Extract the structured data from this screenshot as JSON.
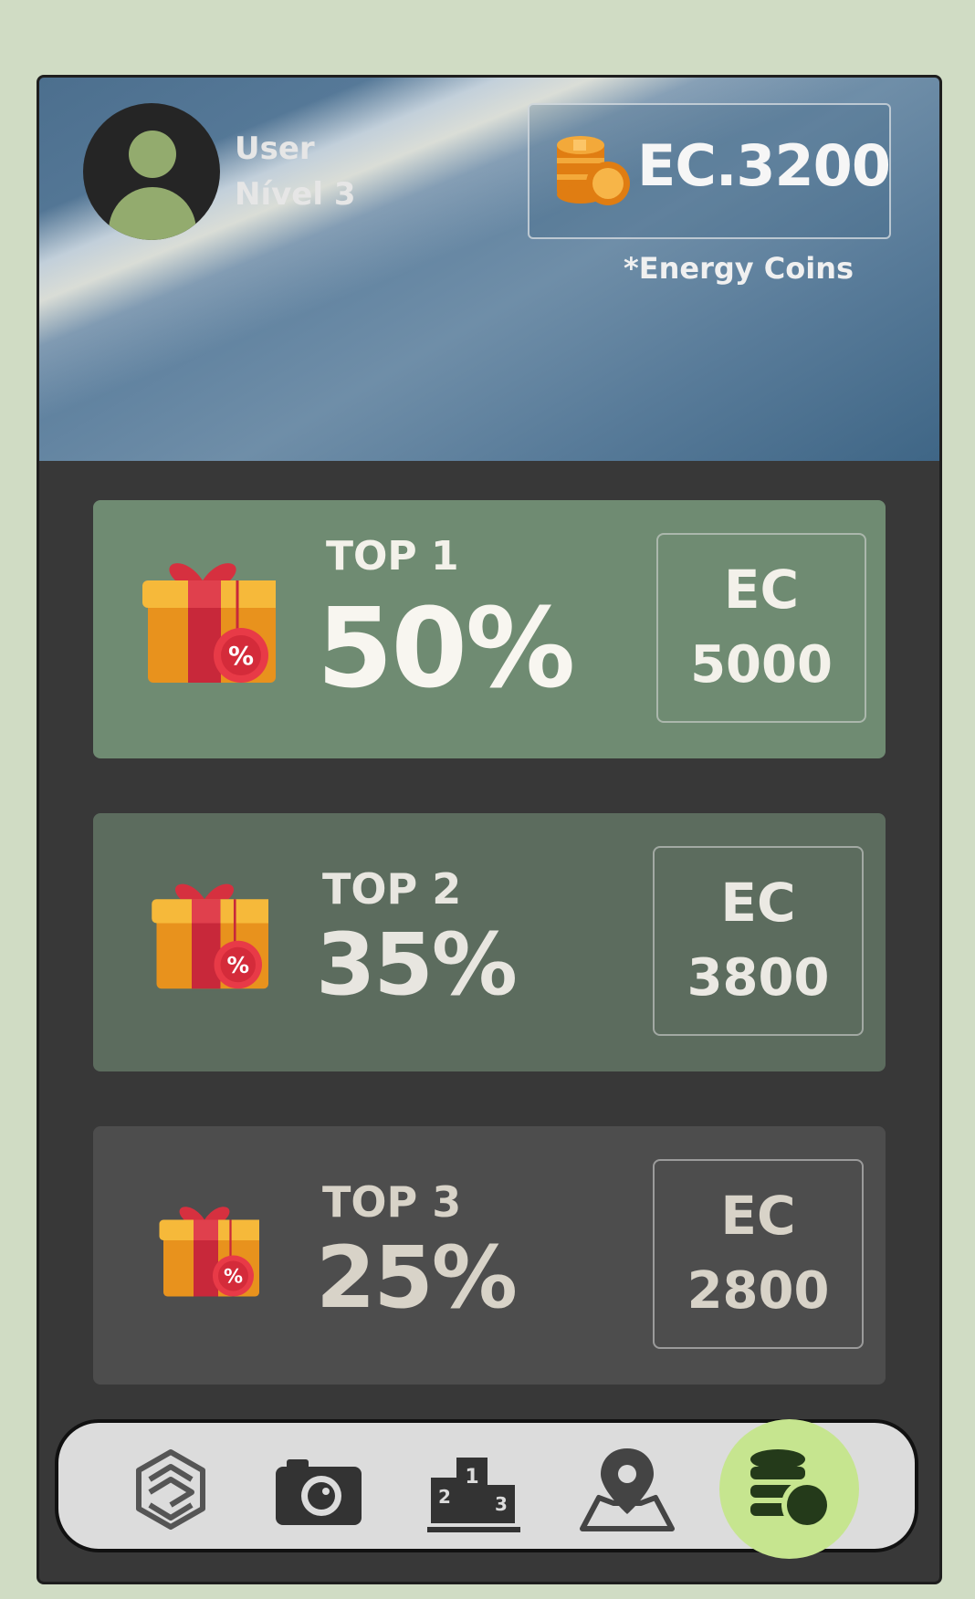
{
  "user": {
    "name": "User",
    "level": "Nível 3"
  },
  "wallet": {
    "balance": "EC.3200",
    "note": "*Energy Coins"
  },
  "rewards": [
    {
      "rank": "TOP 1",
      "discount": "50%",
      "currency": "EC",
      "cost": "5000"
    },
    {
      "rank": "TOP 2",
      "discount": "35%",
      "currency": "EC",
      "cost": "3800"
    },
    {
      "rank": "TOP 3",
      "discount": "25%",
      "currency": "EC",
      "cost": "2800"
    }
  ],
  "nav": {
    "items": [
      "logo-icon",
      "camera-icon",
      "podium-icon",
      "map-pin-icon",
      "coins-icon"
    ],
    "active": "coins-icon"
  },
  "colors": {
    "background": "#d0dcc4",
    "panel": "#383838",
    "card1": "#6f8b72",
    "card2": "#5c6c5e",
    "card3": "#4d4d4d",
    "accent": "#c6e58f",
    "avatar": "#93ab6e"
  }
}
